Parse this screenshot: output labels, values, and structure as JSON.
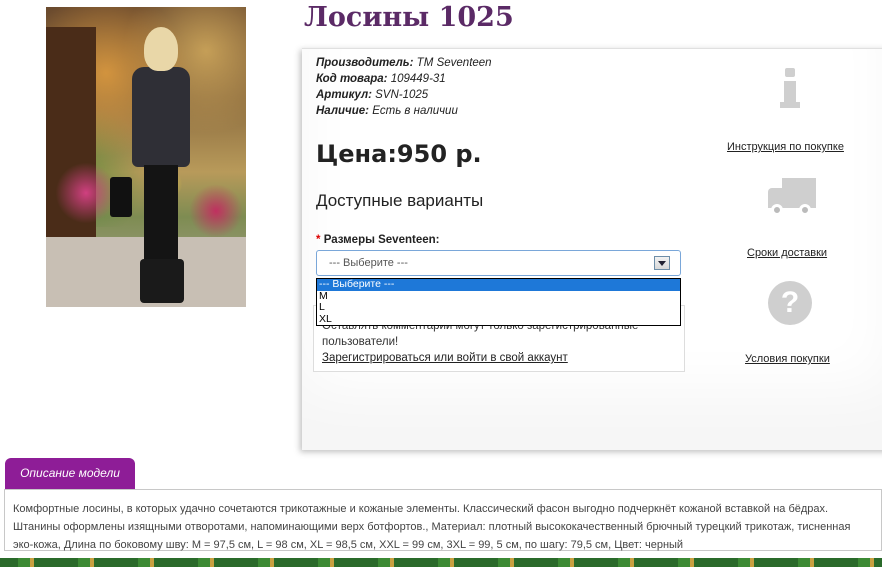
{
  "product": {
    "title": "Лосины 1025",
    "meta": [
      {
        "label": "Производитель:",
        "value": "ТМ Seventeen"
      },
      {
        "label": "Код товара:",
        "value": "109449-31"
      },
      {
        "label": "Артикул:",
        "value": "SVN-1025"
      },
      {
        "label": "Наличие:",
        "value": "Есть в наличии"
      }
    ],
    "price": "Цена:950 р.",
    "variants_heading": "Доступные варианты",
    "size_label": "Размеры Seventeen:",
    "required_mark": "*",
    "select_value": "--- Выберите ---",
    "dropdown_options": [
      "--- Выберите ---",
      "M",
      "L",
      "XL"
    ],
    "notice_line1": "Оставлять комментарии могут только зарегистрированные",
    "notice_line2": "пользователи!",
    "notice_link": "Зарегистрироваться или войти в свой аккаунт"
  },
  "sidebar": {
    "instructions_link": "Инструкция по покупке",
    "delivery_link": "Сроки доставки",
    "terms_link": "Условия покупки",
    "help_glyph": "?",
    "icons": [
      "info-icon",
      "truck-icon",
      "question-icon"
    ]
  },
  "description": {
    "tab_label": "Описание модели",
    "text": "Комфортные лосины, в которых удачно сочетаются трикотажные и кожаные элементы. Классический фасон выгодно подчеркнёт кожаной вставкой на бёдрах. Штанины оформлены изящными отворотами, напоминающими верх ботфортов., Материал: плотный высококачественный брючный турецкий трикотаж, тисненная эко-кожа, Длина по боковому шву: M = 97,5 см, L = 98 см, XL = 98,5 см, XXL = 99 см, 3XL = 99, 5 см, по шагу: 79,5 см, Цвет: черный"
  },
  "colors": {
    "accent": "#8e1d97",
    "title": "#5b2a66",
    "selected_option": "#1e78d8"
  }
}
